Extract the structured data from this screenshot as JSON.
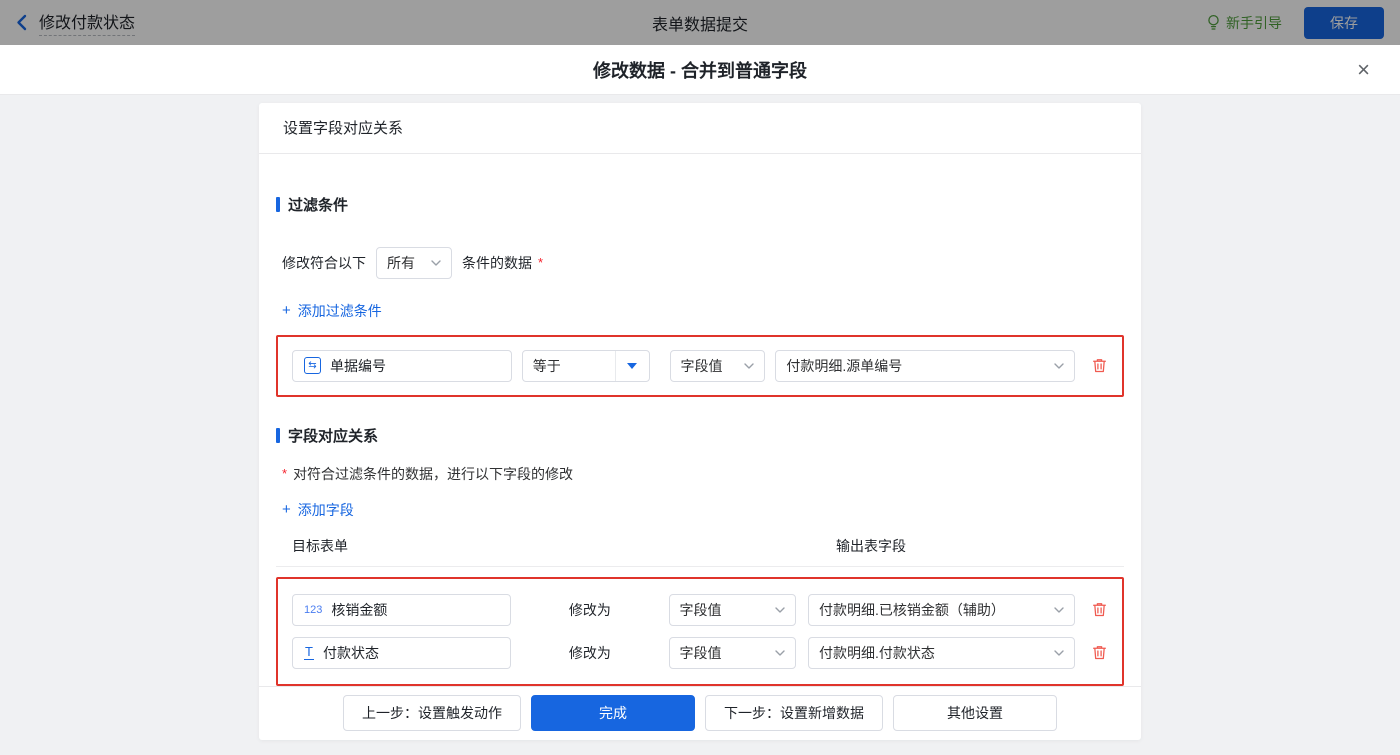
{
  "topbar": {
    "back_label": "修改付款状态",
    "center_title": "表单数据提交",
    "guide_label": "新手引导",
    "save_label": "保存"
  },
  "modal": {
    "title": "修改数据 - 合并到普通字段",
    "close_glyph": "×"
  },
  "card": {
    "header": "设置字段对应关系",
    "filter_section": {
      "title": "过滤条件",
      "prefix": "修改符合以下",
      "match_select_value": "所有",
      "suffix": "条件的数据",
      "required_mark": "*",
      "add_plus": "+",
      "add_label": "添加过滤条件",
      "condition": {
        "field": "单据编号",
        "field_icon_glyph": "⇆",
        "operator": "等于",
        "value_type": "字段值",
        "value": "付款明细.源单编号"
      }
    },
    "mapping_section": {
      "title": "字段对应关系",
      "hint_mark": "*",
      "hint": "对符合过滤条件的数据，进行以下字段的修改",
      "add_plus": "+",
      "add_label": "添加字段",
      "col_target": "目标表单",
      "col_output": "输出表字段",
      "modify_label": "修改为",
      "rows": [
        {
          "field": "核销金额",
          "icon_glyph": "123",
          "value_type": "字段值",
          "value": "付款明细.已核销金额（辅助）"
        },
        {
          "field": "付款状态",
          "icon_glyph": "T",
          "value_type": "字段值",
          "value": "付款明细.付款状态"
        }
      ]
    },
    "footer": {
      "prev_label": "上一步：设置触发动作",
      "done_label": "完成",
      "next_label": "下一步：设置新增数据",
      "other_label": "其他设置"
    }
  },
  "colors": {
    "accent_blue": "#1766e0",
    "alert_red_border": "#e0342b",
    "trash_red": "#f05a50",
    "guide_green": "#4f9e3c",
    "required_red": "#f5222d"
  }
}
